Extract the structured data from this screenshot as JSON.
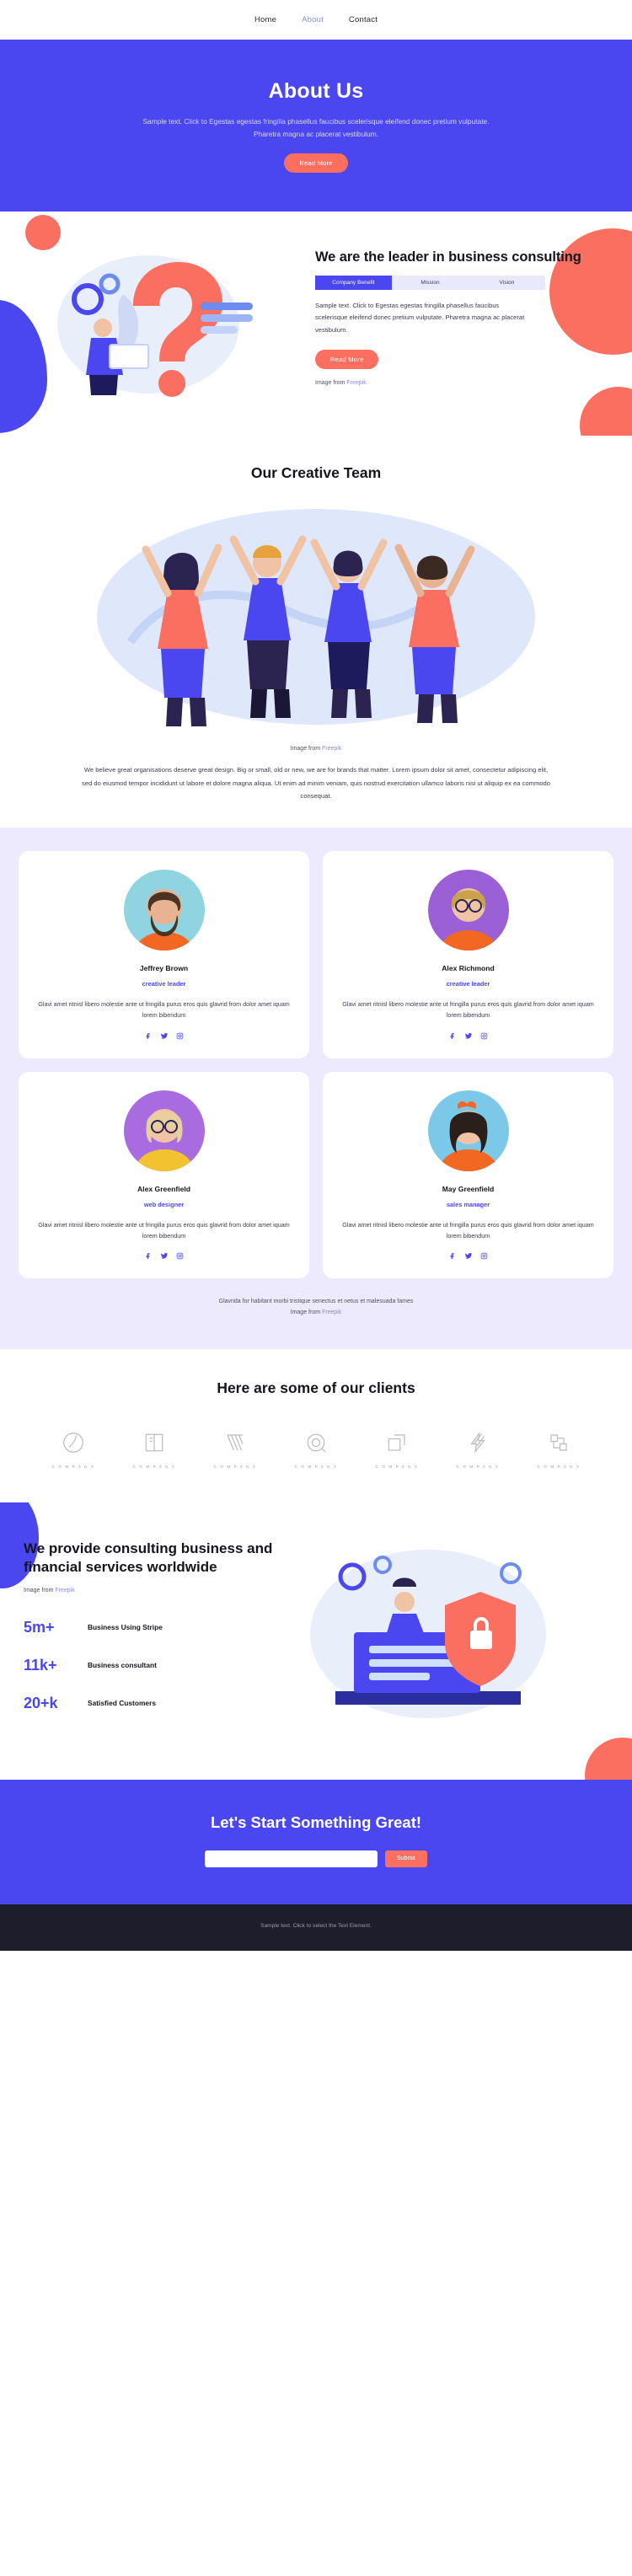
{
  "nav": {
    "items": [
      {
        "label": "Home",
        "active": false
      },
      {
        "label": "About",
        "active": true
      },
      {
        "label": "Contact",
        "active": false
      }
    ]
  },
  "hero": {
    "title": "About Us",
    "subtitle": "Sample text. Click to Egestas egestas fringilla phasellus faucibus scelerisque eleifend donec pretium vulputate. Pharetra magna ac placerat vestibulum.",
    "button": "Read More"
  },
  "leader": {
    "heading": "We are the leader in business consulting",
    "tabs": [
      {
        "label": "Company Benefit",
        "active": true
      },
      {
        "label": "Mission",
        "active": false
      },
      {
        "label": "Vision",
        "active": false
      }
    ],
    "body": "Sample text. Click to Egestas egestas fringilla phasellus faucibus scelerisque eleifend donec pretium vulputate. Pharetra magna ac placerat vestibulum.",
    "button": "Read More",
    "credit_prefix": "Image from ",
    "credit_link": "Freepik"
  },
  "team": {
    "heading": "Our Creative Team",
    "credit_prefix": "Image from ",
    "credit_link": "Freepik",
    "paragraph": "We believe great organisations deserve great design. Big or small, old or new, we are for brands that matter. Lorem ipsum dolor sit amet, consectetur adipiscing elit, sed do eiusmod tempor incididunt ut labore et dolore magna aliqua. Ut enim ad minim veniam, quis nostrud exercitation ullamco laboris nisi ut aliquip ex ea commodo consequat.",
    "members": [
      {
        "name": "Jeffrey Brown",
        "role": "creative leader",
        "desc": "Glavi amet ritnisl libero molestie ante ut fringilla purus eros quis glavrid from dolor amet iquam lorem bibendum",
        "avatar_bg": "#8fd4e0",
        "shirt": "#f26722",
        "hair": "#6b4a2f",
        "skin": "#e8b392"
      },
      {
        "name": "Alex Richmond",
        "role": "creative leader",
        "desc": "Glavi amet ritnisl libero molestie ante ut fringilla purus eros quis glavrid from dolor amet iquam lorem bibendum",
        "avatar_bg": "#9b5fd6",
        "shirt": "#f26722",
        "hair": "#caa24a",
        "skin": "#f0c3a4"
      },
      {
        "name": "Alex Greenfield",
        "role": "web designer",
        "desc": "Glavi amet ritnisl libero molestie ante ut fringilla purus eros quis glavrid from dolor amet iquam lorem bibendum",
        "avatar_bg": "#a86ce0",
        "shirt": "#f2c230",
        "hair": "#e8cfa0",
        "skin": "#f0c3a4"
      },
      {
        "name": "May Greenfield",
        "role": "sales manager",
        "desc": "Glavi amet ritnisl libero molestie ante ut fringilla purus eros quis glavrid from dolor amet iquam lorem bibendum",
        "avatar_bg": "#7cc8e8",
        "shirt": "#f26722",
        "hair": "#3a2a22",
        "skin": "#f0c3a4"
      }
    ],
    "social": [
      {
        "name": "facebook",
        "glyph": "f"
      },
      {
        "name": "twitter",
        "glyph": "ᴠ"
      },
      {
        "name": "instagram",
        "glyph": "▣"
      }
    ],
    "footer_line1": "Glavrida for habitant morbi tristique senectus et netus et malesuada fames",
    "footer_credit_prefix": "Image from ",
    "footer_credit_link": "Freepik"
  },
  "clients": {
    "heading": "Here are some of our clients",
    "logos": [
      {
        "caption": "C O M P A N Y",
        "mark": "circle-swirl-logo"
      },
      {
        "caption": "C O M P A N Y",
        "mark": "book-logo"
      },
      {
        "caption": "C O M P A N Y",
        "mark": "lines-logo"
      },
      {
        "caption": "C O M P A N Y",
        "mark": "ring-logo"
      },
      {
        "caption": "C O M P A N Y",
        "mark": "square-arrow-logo"
      },
      {
        "caption": "C O M P A N Y",
        "mark": "bolt-logo"
      },
      {
        "caption": "C O M P A N Y",
        "mark": "brackets-logo"
      }
    ]
  },
  "provide": {
    "heading": "We provide consulting business and financial services worldwide",
    "credit_prefix": "Image from ",
    "credit_link": "Freepik",
    "stats": [
      {
        "value": "5m+",
        "label": "Business Using Stripe"
      },
      {
        "value": "11k+",
        "label": "Business consultant"
      },
      {
        "value": "20+k",
        "label": "Satisfied Customers"
      }
    ]
  },
  "cta": {
    "heading": "Let's Start Something Great!",
    "input_value": "",
    "input_placeholder": "",
    "submit": "Submit"
  },
  "footer": {
    "text": "Sample text. Click to select the Text Element."
  },
  "colors": {
    "brand_blue": "#4a46f0",
    "accent_coral": "#fb6f61",
    "lavender_bg": "#eceafc",
    "dark_footer": "#1d1d2b"
  }
}
